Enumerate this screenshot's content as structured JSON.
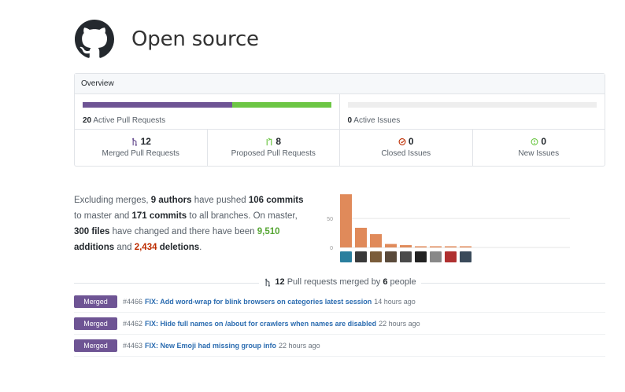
{
  "header": {
    "title": "Open source",
    "logo_icon": "github-octocat-icon"
  },
  "overview": {
    "heading": "Overview",
    "pull_requests": {
      "count": "20",
      "label": "Active Pull Requests",
      "merged_fraction": 0.6,
      "proposed_fraction": 0.4,
      "merged_color": "#6e5494",
      "proposed_color": "#6cc644"
    },
    "issues": {
      "count": "0",
      "label": "Active Issues"
    },
    "stats": [
      {
        "value": "12",
        "label": "Merged Pull Requests",
        "icon": "git-merge-icon",
        "color": "#6e5494"
      },
      {
        "value": "8",
        "label": "Proposed Pull Requests",
        "icon": "git-pull-request-icon",
        "color": "#6cc644"
      },
      {
        "value": "0",
        "label": "Closed Issues",
        "icon": "issue-closed-icon",
        "color": "#bd2c00"
      },
      {
        "value": "0",
        "label": "New Issues",
        "icon": "issue-opened-icon",
        "color": "#6cc644"
      }
    ]
  },
  "summary": {
    "t1": "Excluding merges, ",
    "authors": "9 authors",
    "t2": " have pushed ",
    "commits_master": "106 commits",
    "t3": " to master and ",
    "commits_all": "171 commits",
    "t4": " to all branches. On master, ",
    "files": "300 files",
    "t5": " have changed and there have been ",
    "additions": "9,510",
    "t6": " ",
    "additions_word": "additions",
    "t7": " and ",
    "deletions": "2,434",
    "t8": " ",
    "deletions_word": "deletions",
    "t9": "."
  },
  "chart_data": {
    "type": "bar",
    "categories": [
      "author-1",
      "author-2",
      "author-3",
      "author-4",
      "author-5",
      "author-6",
      "author-7",
      "author-8",
      "author-9"
    ],
    "values": [
      92,
      34,
      23,
      6,
      4,
      2,
      2,
      2,
      2
    ],
    "y_ticks": [
      "50",
      "0"
    ],
    "ylim": [
      0,
      95
    ],
    "bar_color": "#e08a5a",
    "grid": true
  },
  "pull_requests": {
    "count": "12",
    "t1": " Pull requests merged by ",
    "people": "6",
    "t2": " people",
    "items": [
      {
        "badge": "Merged",
        "number": "#4466",
        "title": "FIX: Add word-wrap for blink browsers on categories latest session",
        "time": "14 hours ago"
      },
      {
        "badge": "Merged",
        "number": "#4462",
        "title": "FIX: Hide full names on /about for crawlers when names are disabled",
        "time": "22 hours ago"
      },
      {
        "badge": "Merged",
        "number": "#4463",
        "title": "FIX: New Emoji had missing group info",
        "time": "22 hours ago"
      }
    ]
  }
}
